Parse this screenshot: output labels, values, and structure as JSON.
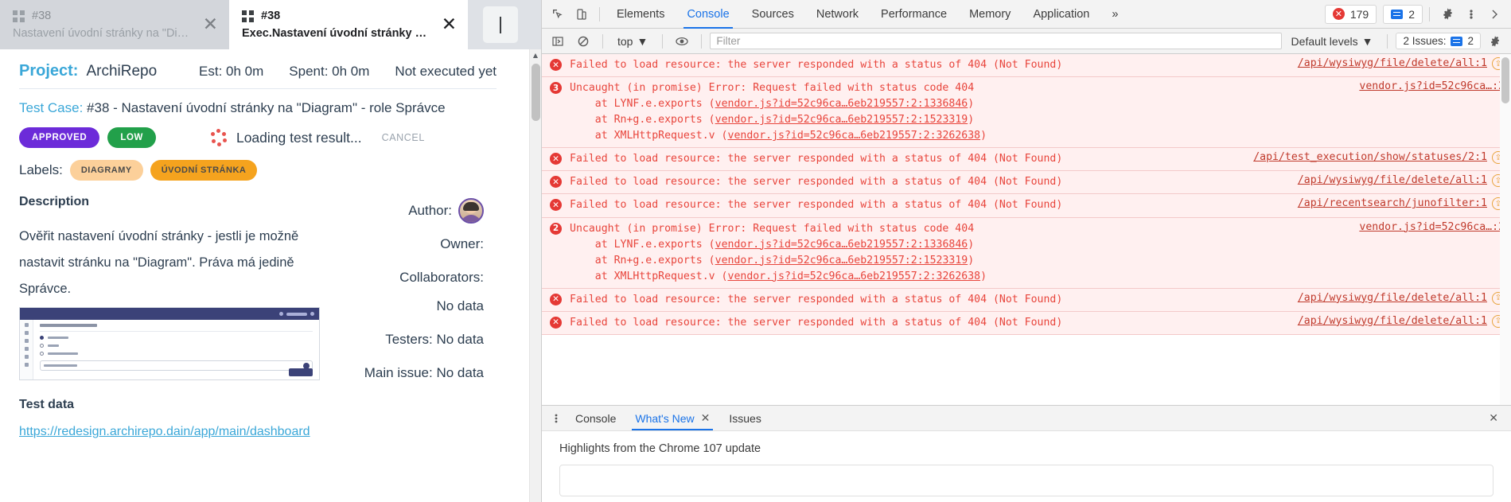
{
  "browser": {
    "tabs": [
      {
        "icon": "grid-icon",
        "number": "#38",
        "title": "Nastavení úvodní stránky na \"Diagram\" - rol...",
        "active": false,
        "close": "✕"
      },
      {
        "icon": "grid-icon",
        "number": "#38",
        "title": "Exec.Nastavení úvodní stránky na \"Diagr...",
        "active": true,
        "close": "✕"
      }
    ]
  },
  "page": {
    "project_label": "Project:",
    "project_value": "ArchiRepo",
    "est": "Est: 0h 0m",
    "spent": "Spent: 0h 0m",
    "status": "Not executed yet",
    "testcase_label": "Test Case:",
    "testcase_value": " #38 - Nastavení úvodní stránky na \"Diagram\" - role Správce",
    "badges": [
      {
        "text": "APPROVED",
        "color": "#6c2bd9"
      },
      {
        "text": "LOW",
        "color": "#22a04a"
      }
    ],
    "loading_text": "Loading test result...",
    "cancel_label": "CANCEL",
    "labels_label": "Labels:",
    "chips": [
      {
        "text": "DIAGRAMY",
        "color": "#fcd09a"
      },
      {
        "text": "ÚVODNÍ STRÁNKA",
        "color": "#f5a31e"
      }
    ],
    "description_heading": "Description",
    "description_text": "Ověřit nastavení úvodní stránky - jestli je možně nastavit stránku na \"Diagram\". Práva má jedině Správce.",
    "author_label": "Author:",
    "owner_label": "Owner:",
    "collaborators_label": "Collaborators:",
    "collaborators_value": "No data",
    "testers_label": "Testers: No data",
    "main_issue_label": "Main issue: No data",
    "testdata_heading": "Test data",
    "testdata_url": "https://redesign.archirepo.dain/app/main/dashboard",
    "thumb_title": "Správa úvodní stránky",
    "thumb_options": [
      "Diagram",
      "URL",
      "Pracovní plocha"
    ],
    "thumb_field_label": "Diagram",
    "thumb_field_value": "Pracovní diagram",
    "thumb_button": "ULOŽIT"
  },
  "devtools": {
    "tabs": [
      "Elements",
      "Console",
      "Sources",
      "Network",
      "Performance",
      "Memory",
      "Application"
    ],
    "selected_tab": "Console",
    "overflow": "»",
    "error_count": "179",
    "warning_count": "2",
    "gear_icon": "gear-icon",
    "kebab_icon": "kebab-icon",
    "close_icon": "✕",
    "filter_placeholder": "Filter",
    "context": "top",
    "levels": "Default levels",
    "issues_text": "2 Issues:",
    "issues_count": "2",
    "messages": [
      {
        "badge": "x",
        "text": "Failed to load resource: the server responded with a status of 404 (Not Found)",
        "link": "/api/wysiwyg/file/delete/all:1",
        "has_nav": true
      },
      {
        "badge": "3",
        "text": "Uncaught (in promise) Error: Request failed with status code 404\n    at LYNF.e.exports (vendor.js?id=52c96ca…6eb219557:2:1336846)\n    at Rn+g.e.exports (vendor.js?id=52c96ca…6eb219557:2:1523319)\n    at XMLHttpRequest.v (vendor.js?id=52c96ca…6eb219557:2:3262638)",
        "link": "vendor.js?id=52c96ca…:2",
        "has_nav": false
      },
      {
        "badge": "x",
        "text": "Failed to load resource: the server responded with a status of 404 (Not Found)",
        "link": "/api/test_execution/show/statuses/2:1",
        "has_nav": true
      },
      {
        "badge": "x",
        "text": "Failed to load resource: the server responded with a status of 404 (Not Found)",
        "link": "/api/wysiwyg/file/delete/all:1",
        "has_nav": true
      },
      {
        "badge": "x",
        "text": "Failed to load resource: the server responded with a status of 404 (Not Found)",
        "link": "/api/recentsearch/junofilter:1",
        "has_nav": true
      },
      {
        "badge": "2",
        "text": "Uncaught (in promise) Error: Request failed with status code 404\n    at LYNF.e.exports (vendor.js?id=52c96ca…6eb219557:2:1336846)\n    at Rn+g.e.exports (vendor.js?id=52c96ca…6eb219557:2:1523319)\n    at XMLHttpRequest.v (vendor.js?id=52c96ca…6eb219557:2:3262638)",
        "link": "vendor.js?id=52c96ca…:2",
        "has_nav": false
      },
      {
        "badge": "x",
        "text": "Failed to load resource: the server responded with a status of 404 (Not Found)",
        "link": "/api/wysiwyg/file/delete/all:1",
        "has_nav": true
      },
      {
        "badge": "x",
        "text": "Failed to load resource: the server responded with a status of 404 (Not Found)",
        "link": "/api/wysiwyg/file/delete/all:1",
        "has_nav": true
      }
    ],
    "drawer": {
      "tabs": [
        {
          "label": "Console",
          "closable": false,
          "selected": false
        },
        {
          "label": "What's New",
          "closable": true,
          "selected": true
        },
        {
          "label": "Issues",
          "closable": false,
          "selected": false
        }
      ],
      "content_title": "Highlights from the Chrome 107 update"
    }
  }
}
